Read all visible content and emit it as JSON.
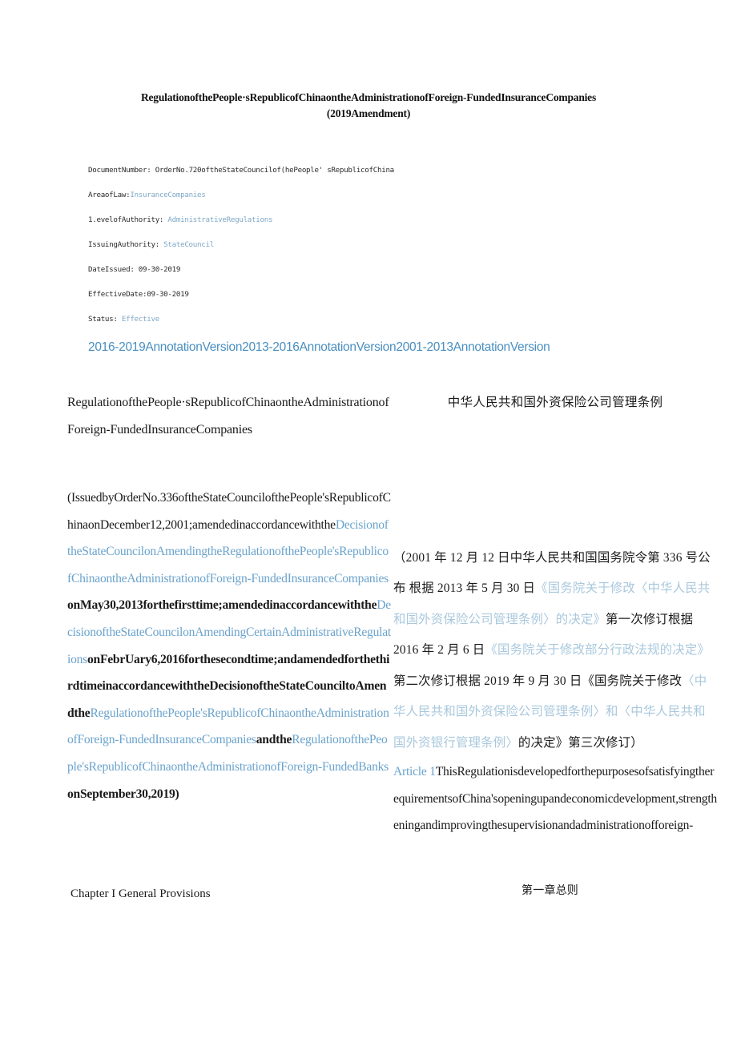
{
  "title": {
    "line1": "RegulationofthePeople·sRepublicofChinaontheAdministrationofForeign-FundedInsuranceCompanies",
    "line2": "(2019Amendment)"
  },
  "metadata": [
    {
      "label": "DocumentNumber:",
      "value": "OrderNo.720oftheStateCouncilof(hePeople' sRepublicofChina",
      "is_link": false
    },
    {
      "label": "AreaofLaw:",
      "value": "InsuranceCompanies",
      "is_link": true
    },
    {
      "label": "1.evelofAuthority:",
      "value": "AdministrativeRegulations",
      "is_link": true
    },
    {
      "label": "IssuingAuthority:",
      "value": "StateCouncil",
      "is_link": true
    },
    {
      "label": "DateIssued:",
      "value": "09-30-2019",
      "is_link": false
    },
    {
      "label": "EffectiveDate:",
      "value": "09-30-2019",
      "is_link": false
    },
    {
      "label": "Status:",
      "value": "Effective",
      "is_link": true
    }
  ],
  "annotation_versions": [
    "2016-2019AnnotationVersion",
    "2013-2016AnnotationVersion",
    "2001-2013AnnotationVersion"
  ],
  "body": {
    "en_title_line1": "RegulationofthePeople·sRepublicofChinaontheAdministrationof",
    "en_title_line2": "Foreign-FundedInsuranceCompanies",
    "zh_title": "中华人民共和国外资保险公司管理条例",
    "en_preamble": {
      "seg1": "(IssuedbyOrderNo.336oftheStateCouncilofthePeople'sRepublicofChinaonDecember12,2001;amendedinaccordancewiththe",
      "seg2_link": "DecisionoftheStateCouncilon",
      "seg3_link": "AmendingtheRegulationofthePeople'sRepublicofChinaontheAdministrationofForeign-FundedInsuranceCompanies",
      "seg4": "onMay30,2013forthefirsttime;amendedinaccordancewiththe",
      "seg5_link": "DecisionoftheStateCouncilonAmendingCertainAdministrativeRegulations",
      "seg6": "onFebrUary6,2016forthesecondtime;andamendedforthethirdtimeinaccordancewiththeDecisionoftheStateCounciltoAmendthe",
      "seg7_link": "RegulationofthePeople'sRepublicofChinaontheAdministrationofForeign-FundedInsuranceCompanies",
      "seg8": "andthe",
      "seg9_link": "RegulationofthePeople'sRepublicofChinaontheAdministrationofForeign-FundedBanks",
      "seg10": "onSeptember30,2019)"
    },
    "zh_preamble": {
      "seg1": "（2001 年 12 月 12 日中华人民共和国国务院令第 336 号公布 根据 2013 年 5 月 30 日",
      "seg2_link": "《国务院关于修改〈中华人民共和国外资保险公司管理条例〉的决定》",
      "seg3": "第一次修订根据 2016 年 2 月 6 日",
      "seg4_link": "《国务院关于修改部分行政法规的决定》",
      "seg5": "第二次修订根据 2019 年 9 月 30 日《国务院关于修改",
      "seg6_link": "〈中华人民共和国外资保险公司管理条例〉和〈中华人民共和国外资银行管理条例〉",
      "seg7": "的决定》第三次修订）"
    },
    "article1": {
      "number": "Article 1",
      "text": "ThisRegulationisdevelopedforthepurposesofsatisfyingtherequirementsofChina'sopeningupandeconomicdevelopment,strengtheningandimprovingthesupervisionandadministrationofforeign-"
    },
    "chapter_en": "Chapter I General Provisions",
    "chapter_zh": "第一章总则"
  },
  "colors": {
    "link_primary": "#4a8fc0",
    "link_body": "#6ba3cc",
    "link_soft": "#a9c8dd",
    "meta_link": "#7fa8c6",
    "text": "#1a1a1a"
  }
}
